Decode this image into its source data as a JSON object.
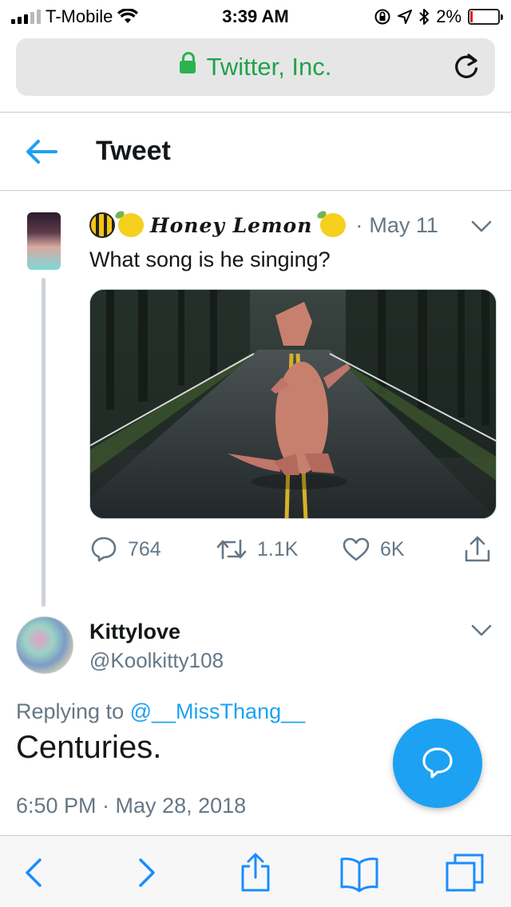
{
  "status_bar": {
    "carrier": "T-Mobile",
    "time": "3:39 AM",
    "battery": "2%",
    "battery_level": 0.02
  },
  "url_bar": {
    "site": "Twitter, Inc."
  },
  "header": {
    "title": "Tweet"
  },
  "tweet": {
    "author_name": "Honey Lemon",
    "separator": "·",
    "date": "May 11",
    "text": "What song is he singing?",
    "replies": "764",
    "retweets": "1.1K",
    "likes": "6K"
  },
  "reply": {
    "name": "Kittylove",
    "handle": "@Koolkitty108",
    "replying_prefix": "Replying to",
    "replying_to": "@__MissThang__",
    "text": "Centuries.",
    "timestamp": "6:50 PM · May 28, 2018"
  },
  "colors": {
    "accent": "#1da1f2",
    "secure": "#1fa34a",
    "muted": "#657786",
    "battery_low": "#e0201b"
  },
  "icons": {
    "status": [
      "signal-icon",
      "wifi-icon",
      "rotation-lock-icon",
      "location-icon",
      "bluetooth-icon",
      "battery-icon"
    ],
    "url_bar": [
      "lock-icon",
      "reload-icon"
    ],
    "tweet_actions": [
      "reply-icon",
      "retweet-icon",
      "like-icon",
      "share-icon"
    ],
    "toolbar": [
      "back-icon",
      "forward-icon",
      "share-icon",
      "bookmarks-icon",
      "tabs-icon"
    ]
  }
}
